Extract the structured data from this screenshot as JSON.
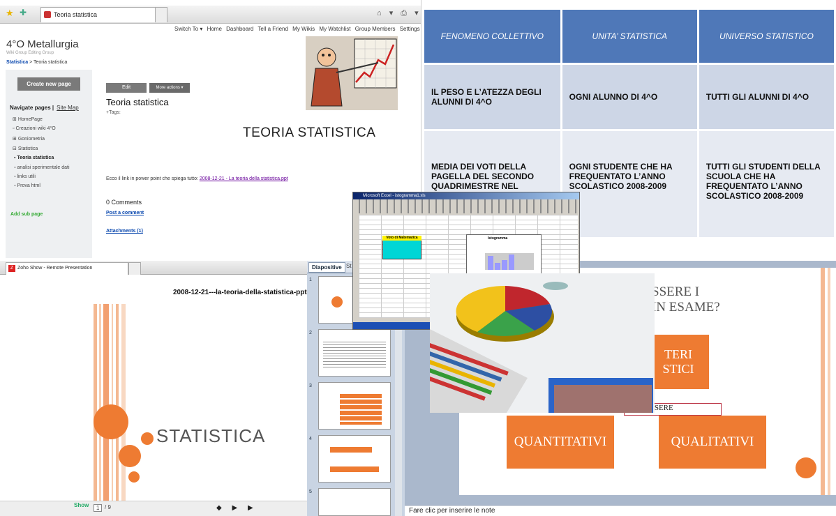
{
  "wiki": {
    "tab_title": "Teoria statistica",
    "top_nav": [
      "Switch To ▾",
      "Home",
      "Dashboard",
      "Tell a Friend",
      "My Wikis",
      "My Watchlist",
      "Group Members",
      "Settings"
    ],
    "site_title": "4°O Metallurgia",
    "site_subtitle": "Wiki Group  Editing Group",
    "breadcrumb_link": "Statistica",
    "breadcrumb_rest": " > Teoria statistica",
    "create_button": "Create new page",
    "nav_heading": "Navigate pages",
    "site_map": "Site Map",
    "nav_items": [
      {
        "marker": "⊞",
        "label": "HomePage"
      },
      {
        "marker": "▫",
        "label": "Creazioni wiki 4°O"
      },
      {
        "marker": "⊞",
        "label": "Goniometria"
      },
      {
        "marker": "⊟",
        "label": "Statistica"
      },
      {
        "marker": "▪",
        "label": "Teoria statistica"
      },
      {
        "marker": "▫",
        "label": "analisi sperimentale dati"
      },
      {
        "marker": "▫",
        "label": "links utili"
      },
      {
        "marker": "▫",
        "label": "Prova html"
      }
    ],
    "add_sub_page": "Add sub page",
    "edit_button": "Edit",
    "more_actions": "More actions ▾",
    "page_title": "Teoria statistica",
    "tags_label": "+Tags:",
    "heading": "TEORIA STATISTICA",
    "link_intro": "Ecco il link in power point che spiega tutto: ",
    "link_text": "2008-12-21 - La teoria della statistica.ppt",
    "comments": "0 Comments",
    "post_comment": "Post a comment",
    "attachments": "Attachments (1)"
  },
  "table_slide": {
    "headers": [
      "FENOMENO COLLETTIVO",
      "UNITA’ STATISTICA",
      "UNIVERSO STATISTICO"
    ],
    "rows": [
      [
        "IL PESO E L’ATEZZA DEGLI ALUNNI DI 4^O",
        "OGNI ALUNNO DI 4^O",
        "TUTTI GLI ALUNNI DI 4^O"
      ],
      [
        "MEDIA DEI VOTI DELLA PAGELLA DEL SECONDO QUADRIMESTRE NEL",
        "OGNI STUDENTE CHE HA FREQUENTATO L’ANNO SCOLASTICO      2008-2009",
        "TUTTI GLI STUDENTI DELLA SCUOLA CHE HA FREQUENTATO L’ANNO SCOLASTICO 2008-2009"
      ]
    ]
  },
  "zoho": {
    "tab_title": "Zoho Show - Remote Presentation",
    "file_name": "2008-12-21---la-teoria-della-statistica-ppt",
    "slide_title": "STATISTICA",
    "logo": "Show",
    "page_number": "1",
    "page_total": "/ 9",
    "nav_buttons": "◆ ▶ ▶"
  },
  "ppt": {
    "tab_active": "Diapositive",
    "tab_other": "St",
    "thumb_numbers": [
      "1",
      "2",
      "3",
      "4",
      "5"
    ],
    "slide_question_1": "SSERE I",
    "slide_question_2": "IN ESAME?",
    "box_top": "TERI\nSTICI",
    "possono": "ESSERE",
    "box_left": "QUANTITATIVI",
    "box_right": "QUALITATIVI",
    "notes_placeholder": "Fare clic per inserire le note"
  },
  "excel": {
    "title": "Microsoft Excel - istogramma1.xls",
    "table_header": "Voto di Matematica",
    "chart_title": "Istogramma"
  },
  "colors": {
    "accent_orange": "#ee7b32",
    "table_header_blue": "#4f78b8"
  }
}
